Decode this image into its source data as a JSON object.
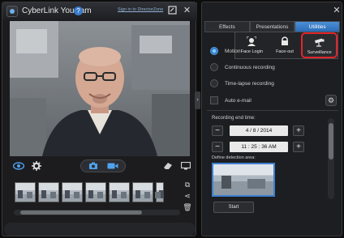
{
  "app": {
    "title": "CyberLink YouCam",
    "signin_link": "Sign in to DirectorZone"
  },
  "tabs": [
    {
      "label": "Effects"
    },
    {
      "label": "Presentations"
    },
    {
      "label": "Utilities",
      "active": true
    }
  ],
  "utilities_menu": [
    {
      "label": "Face Login",
      "icon": "face-login-icon"
    },
    {
      "label": "Face-out",
      "icon": "lock-icon"
    },
    {
      "label": "Surveillance",
      "icon": "camera-icon",
      "highlighted": true
    }
  ],
  "options": {
    "motion_detection": "Motion",
    "continuous_recording": "Continuous recording",
    "time_lapse_recording": "Time-lapse recording",
    "auto_email": "Auto e-mail"
  },
  "recording": {
    "end_time_label": "Recording end time:",
    "date": "4   / 8  / 2014",
    "time": "11 : 25 : 36  AM",
    "detection_area_label": "Define detection area:",
    "start_label": "Start"
  },
  "colors": {
    "accent_blue": "#3b7ccc",
    "highlight_red": "#e0262b"
  }
}
